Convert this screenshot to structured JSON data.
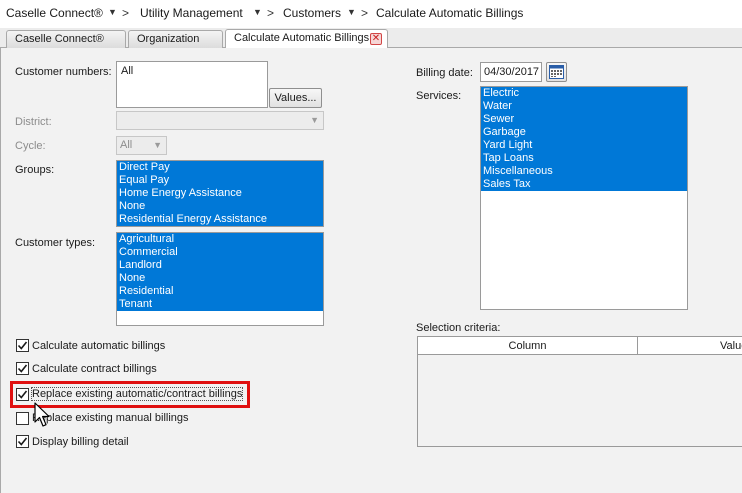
{
  "breadcrumb": {
    "items": [
      "Caselle Connect®",
      "Utility Management",
      "Customers",
      "Calculate Automatic Billings"
    ],
    "sep": ">"
  },
  "tabs": [
    {
      "label": "Caselle Connect®"
    },
    {
      "label": "Organization"
    },
    {
      "label": "Calculate Automatic Billings",
      "close": "✕"
    }
  ],
  "form": {
    "customer_numbers": {
      "label": "Customer numbers:",
      "value": "All",
      "button": "Values..."
    },
    "district": {
      "label": "District:",
      "value": ""
    },
    "cycle": {
      "label": "Cycle:",
      "value": "All"
    },
    "groups": {
      "label": "Groups:",
      "items": [
        "Direct Pay",
        "Equal Pay",
        "Home Energy Assistance",
        "None",
        "Residential Energy Assistance"
      ]
    },
    "customer_types": {
      "label": "Customer types:",
      "items": [
        "Agricultural",
        "Commercial",
        "Landlord",
        "None",
        "Residential",
        "Tenant"
      ]
    },
    "billing_date": {
      "label": "Billing date:",
      "value": "04/30/2017"
    },
    "services": {
      "label": "Services:",
      "items": [
        "Electric",
        "Water",
        "Sewer",
        "Garbage",
        "Yard Light",
        "Tap Loans",
        "Miscellaneous",
        "Sales Tax"
      ]
    },
    "selection_criteria": {
      "label": "Selection criteria:",
      "columns": [
        "Column",
        "Value"
      ]
    },
    "checkboxes": [
      {
        "label": "Calculate automatic billings",
        "checked": true
      },
      {
        "label": "Calculate contract billings",
        "checked": true
      },
      {
        "label": "Replace existing automatic/contract billings",
        "checked": true
      },
      {
        "label": "Replace existing manual billings",
        "checked": false
      },
      {
        "label": "Display billing detail",
        "checked": true
      }
    ]
  },
  "colors": {
    "selection": "#0078d7",
    "highlight": "#e01010"
  },
  "icons": {
    "calendar": "calendar-icon",
    "cursor": "mouse-pointer-icon",
    "dropdown": "chevron-down-icon"
  }
}
